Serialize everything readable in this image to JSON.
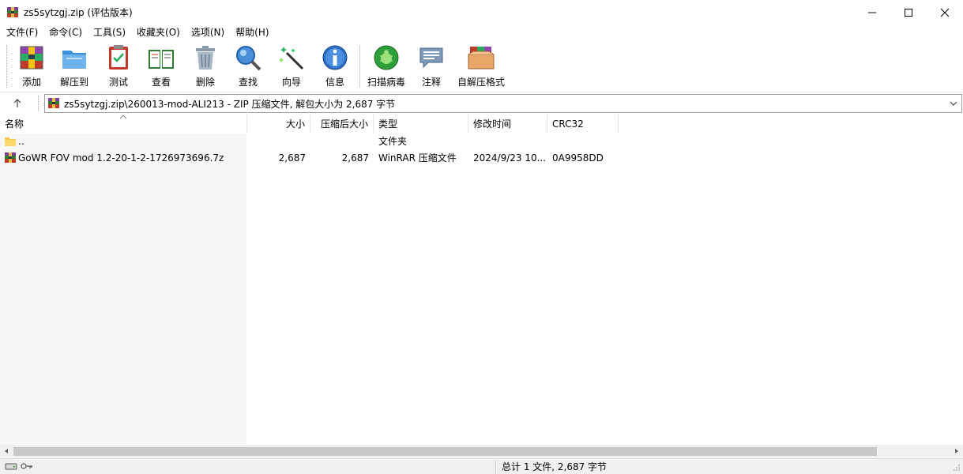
{
  "window": {
    "title": "zs5sytzgj.zip (评估版本)"
  },
  "menu": [
    "文件(F)",
    "命令(C)",
    "工具(S)",
    "收藏夹(O)",
    "选项(N)",
    "帮助(H)"
  ],
  "toolbar": {
    "buttons": [
      {
        "label": "添加",
        "icon": "add-archive-icon"
      },
      {
        "label": "解压到",
        "icon": "extract-folder-icon"
      },
      {
        "label": "测试",
        "icon": "test-clipboard-icon"
      },
      {
        "label": "查看",
        "icon": "view-book-icon"
      },
      {
        "label": "删除",
        "icon": "trash-icon"
      },
      {
        "label": "查找",
        "icon": "magnifier-icon"
      },
      {
        "label": "向导",
        "icon": "wizard-wand-icon"
      },
      {
        "label": "信息",
        "icon": "info-icon"
      },
      {
        "label": "扫描病毒",
        "icon": "virus-scan-icon"
      },
      {
        "label": "注释",
        "icon": "comment-icon"
      },
      {
        "label": "自解压格式",
        "icon": "sfx-box-icon"
      }
    ]
  },
  "address": {
    "path": "zs5sytzgj.zip\\260013-mod-ALI213 - ZIP 压缩文件, 解包大小为 2,687 字节"
  },
  "columns": {
    "name": "名称",
    "size": "大小",
    "packed": "压缩后大小",
    "type": "类型",
    "modified": "修改时间",
    "crc": "CRC32"
  },
  "files": [
    {
      "name": "..",
      "size": "",
      "packed": "",
      "type": "文件夹",
      "modified": "",
      "crc": "",
      "icon": "folder-icon"
    },
    {
      "name": "GoWR FOV mod 1.2-20-1-2-1726973696.7z",
      "size": "2,687",
      "packed": "2,687",
      "type": "WinRAR 压缩文件",
      "modified": "2024/9/23 10...",
      "crc": "0A9958DD",
      "icon": "rar-archive-icon"
    }
  ],
  "status": {
    "summary": "总计 1 文件, 2,687 字节"
  }
}
